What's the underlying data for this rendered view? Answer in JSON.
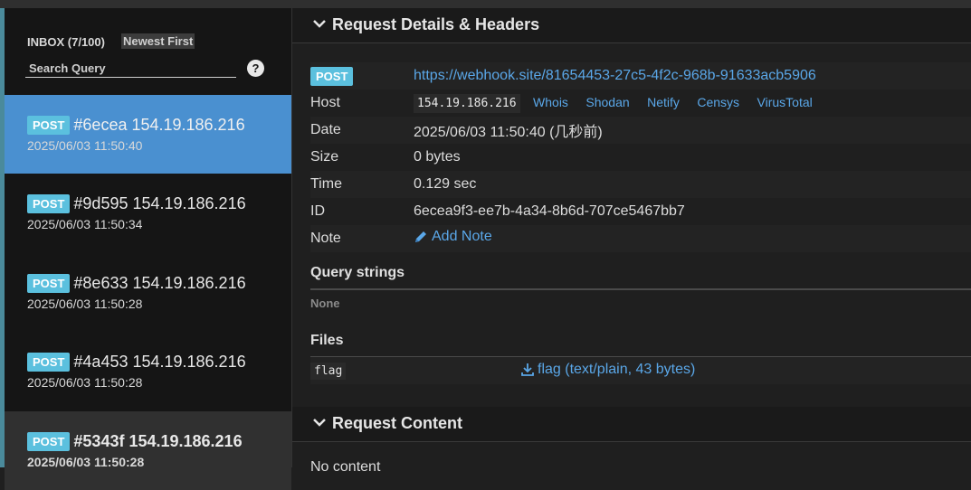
{
  "sidebar": {
    "inbox_label": "INBOX (7/100)",
    "sort_label": "Newest First",
    "search_placeholder": "Search Query",
    "help_label": "?",
    "requests": [
      {
        "method": "POST",
        "title": "#6ecea 154.19.186.216",
        "time": "2025/06/03 11:50:40",
        "state": "active"
      },
      {
        "method": "POST",
        "title": "#9d595 154.19.186.216",
        "time": "2025/06/03 11:50:34",
        "state": "normal"
      },
      {
        "method": "POST",
        "title": "#8e633 154.19.186.216",
        "time": "2025/06/03 11:50:28",
        "state": "normal"
      },
      {
        "method": "POST",
        "title": "#4a453 154.19.186.216",
        "time": "2025/06/03 11:50:28",
        "state": "normal"
      },
      {
        "method": "POST",
        "title": "#5343f 154.19.186.216",
        "time": "2025/06/03 11:50:28",
        "state": "hover"
      }
    ]
  },
  "details": {
    "header_title": "Request Details & Headers",
    "method": "POST",
    "url": "https://webhook.site/81654453-27c5-4f2c-968b-91633acb5906",
    "host_label": "Host",
    "host_ip": "154.19.186.216",
    "host_links": [
      "Whois",
      "Shodan",
      "Netify",
      "Censys",
      "VirusTotal"
    ],
    "date_label": "Date",
    "date_value": "2025/06/03 11:50:40 (几秒前)",
    "size_label": "Size",
    "size_value": "0 bytes",
    "time_label": "Time",
    "time_value": "0.129 sec",
    "id_label": "ID",
    "id_value": "6ecea9f3-ee7b-4a34-8b6d-707ce5467bb7",
    "note_label": "Note",
    "add_note_label": "Add Note",
    "query_title": "Query strings",
    "query_none": "None",
    "files_title": "Files",
    "file_name": "flag",
    "file_link": "flag (text/plain, 43 bytes)"
  },
  "content": {
    "header_title": "Request Content",
    "no_content": "No content"
  },
  "colors": {
    "accent": "#4a90d0",
    "post_badge": "#5bc0de",
    "link": "#5aa7e8"
  }
}
